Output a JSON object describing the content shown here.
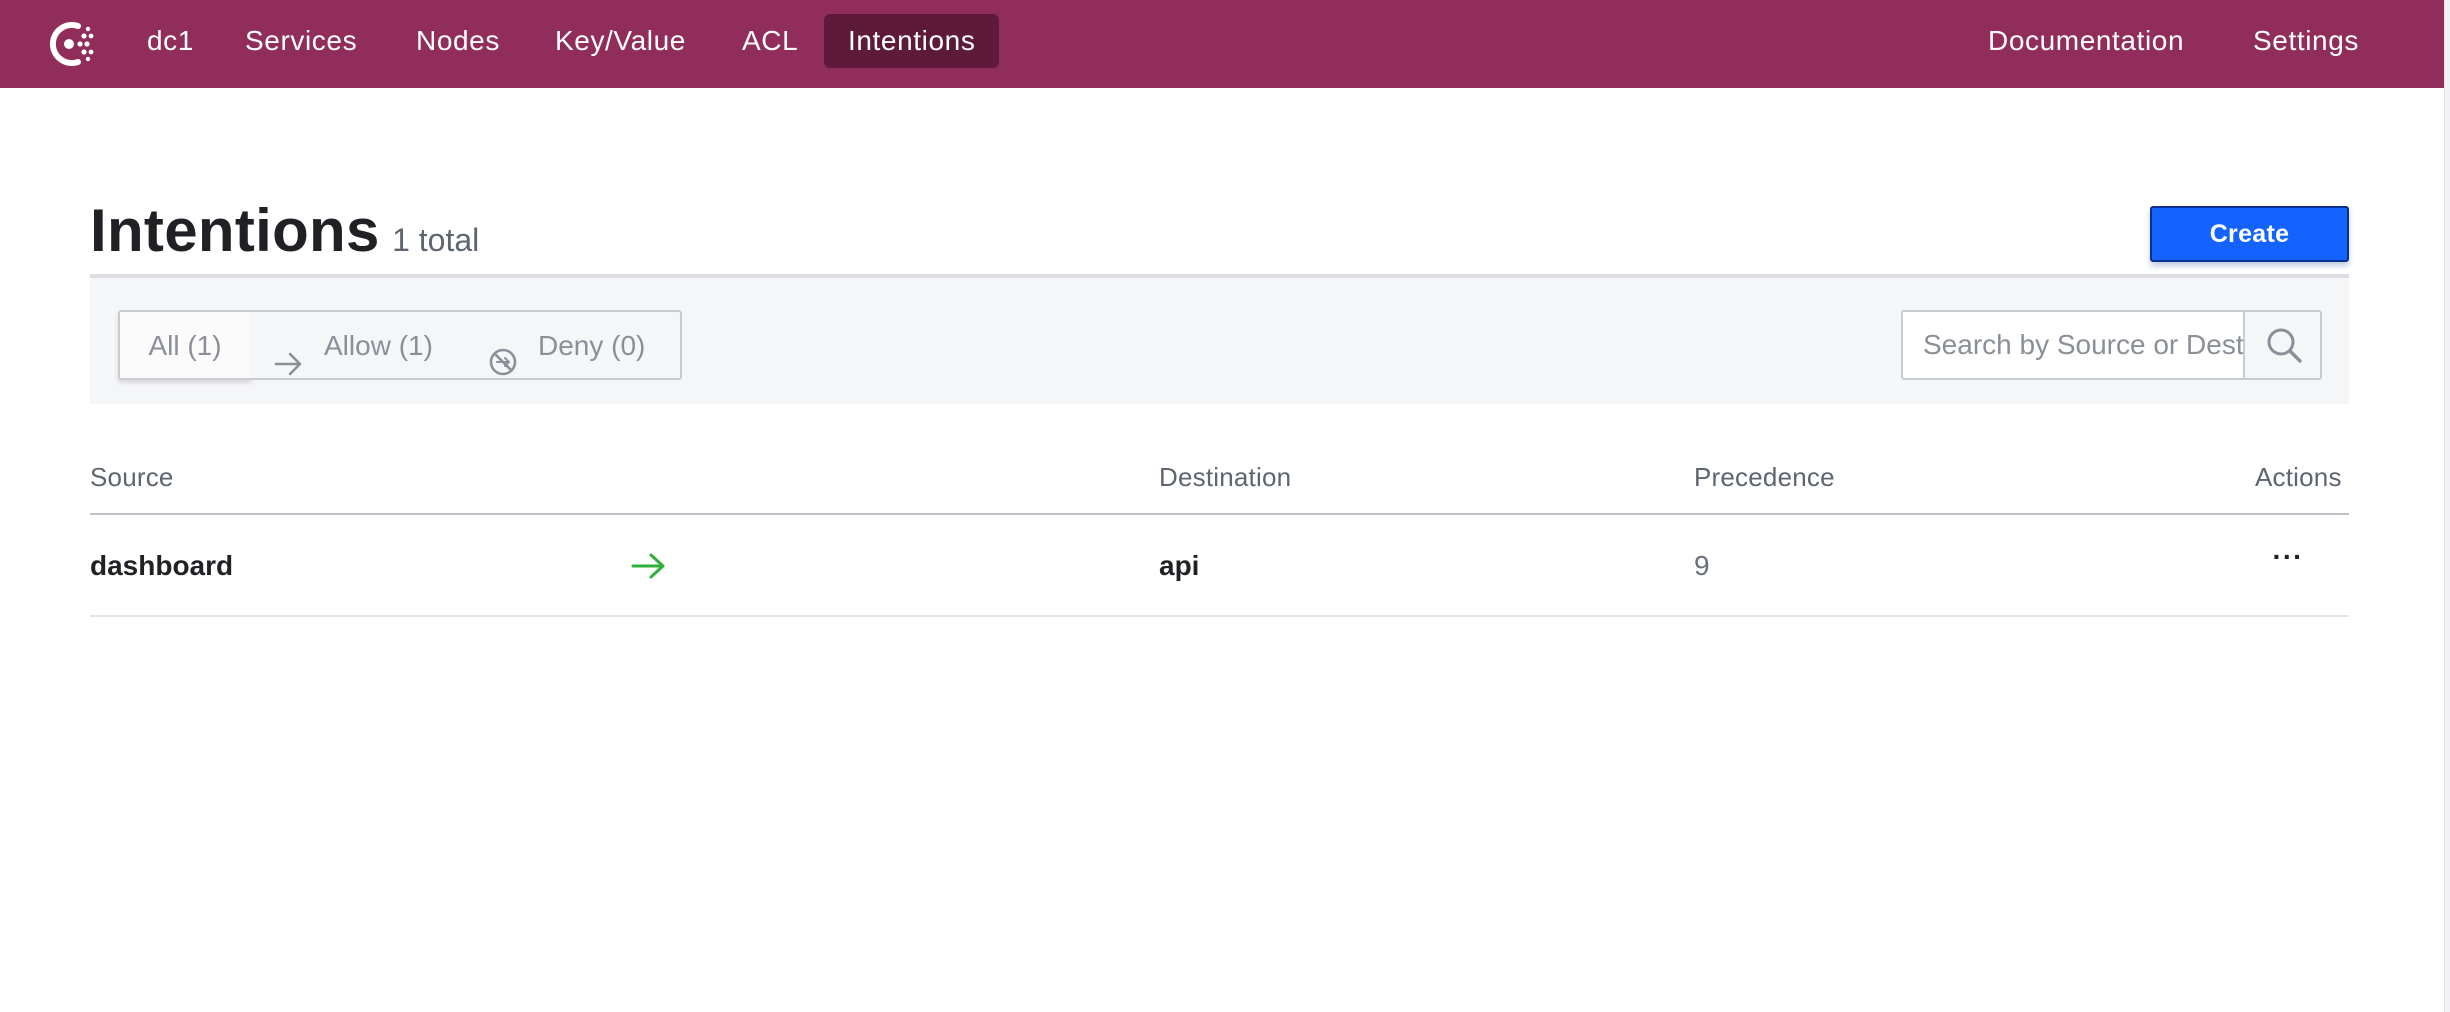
{
  "nav": {
    "logo_icon": "consul-logo-icon",
    "items": [
      {
        "label": "dc1"
      },
      {
        "label": "Services"
      },
      {
        "label": "Nodes"
      },
      {
        "label": "Key/Value"
      },
      {
        "label": "ACL"
      },
      {
        "label": "Intentions",
        "active": true
      }
    ],
    "right_items": [
      {
        "label": "Documentation"
      },
      {
        "label": "Settings"
      }
    ],
    "bar_color": "#912d5b",
    "active_color": "#5e1a39"
  },
  "page": {
    "title": "Intentions",
    "count_label": "1 total",
    "create_label": "Create",
    "create_color": "#1563ff"
  },
  "filters": {
    "tabs": [
      {
        "label": "All (1)",
        "selected": true
      },
      {
        "label": "Allow (1)",
        "icon": "arrow-right-icon"
      },
      {
        "label": "Deny (0)",
        "icon": "deny-icon"
      }
    ],
    "search": {
      "placeholder": "Search by Source or Destination",
      "value": "",
      "icon": "search-icon"
    }
  },
  "table": {
    "columns": [
      "Source",
      "Destination",
      "Precedence",
      "Actions"
    ],
    "rows": [
      {
        "source": "dashboard",
        "action": "allow",
        "action_icon": "arrow-right-icon",
        "action_color": "#2eb039",
        "destination": "api",
        "precedence": "9",
        "actions_label": "···"
      }
    ]
  }
}
